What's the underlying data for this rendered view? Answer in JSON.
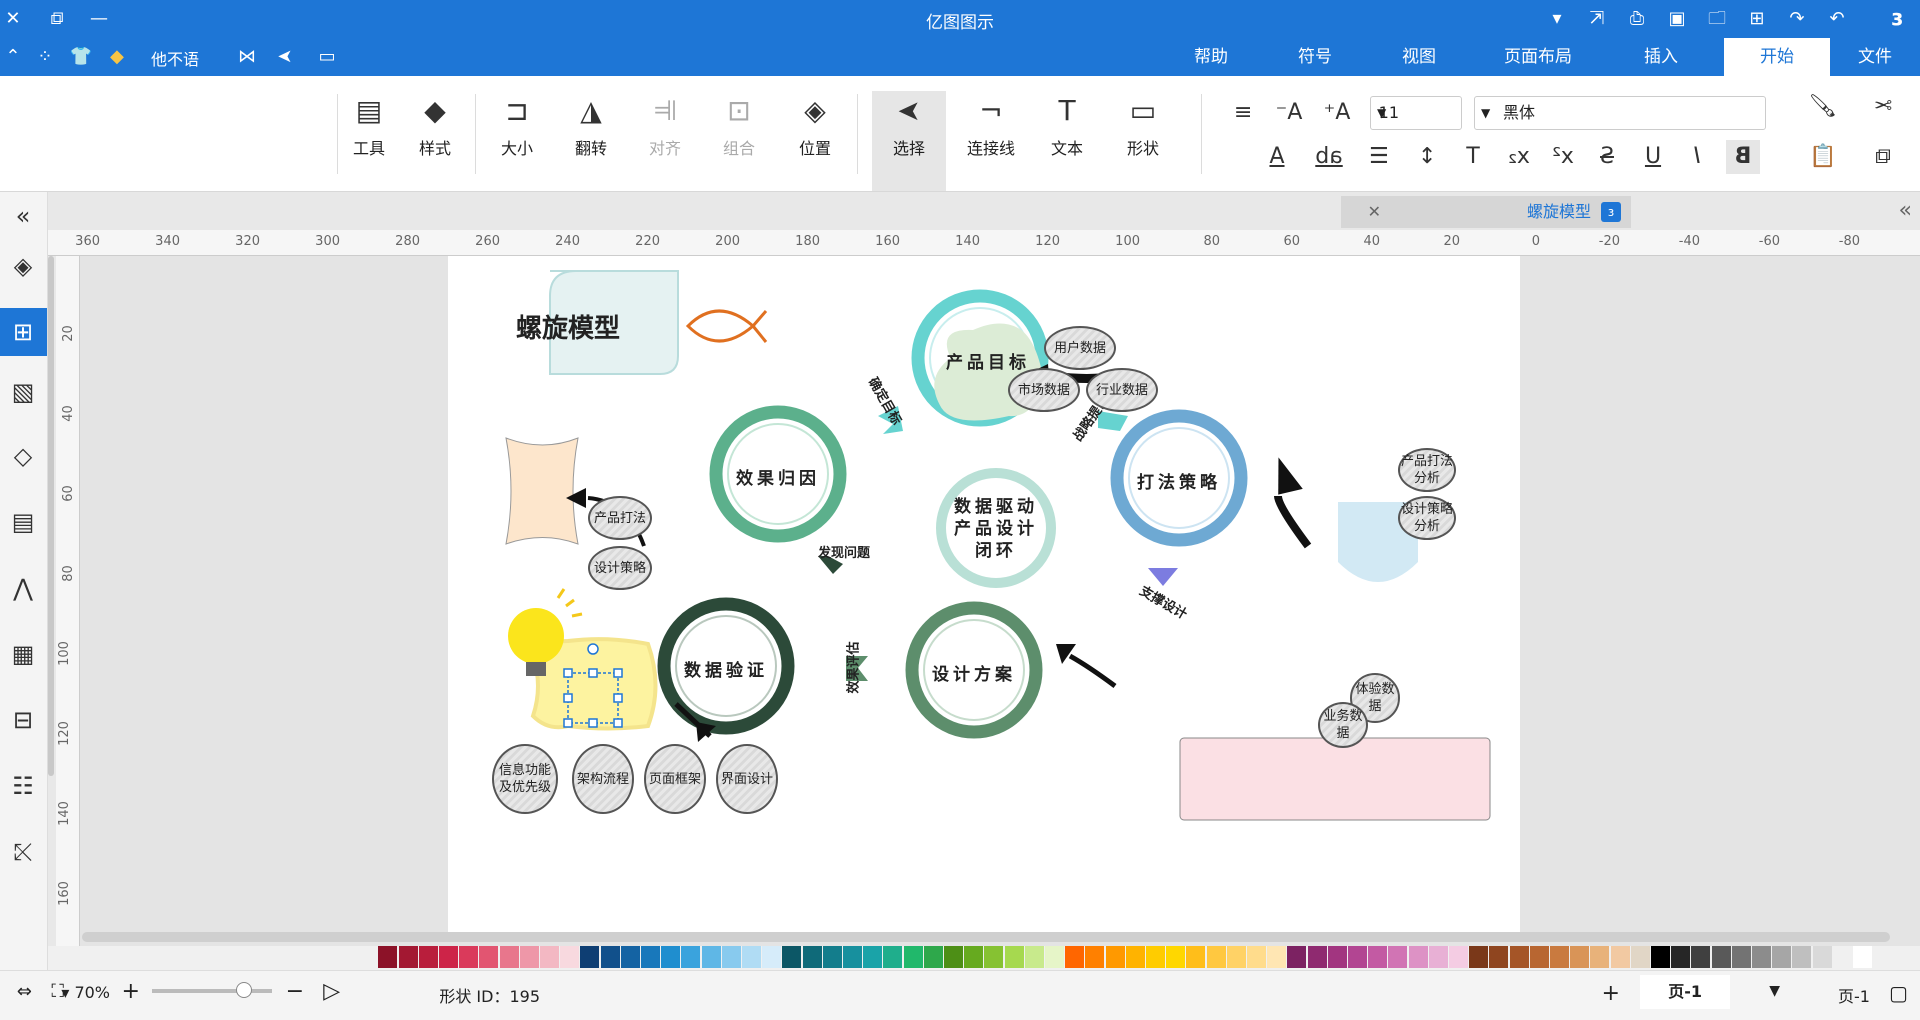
{
  "titlebar": {
    "title": "亿图图示"
  },
  "tabs": [
    "文件",
    "开始",
    "插入",
    "页面布局",
    "视图",
    "符号",
    "帮助"
  ],
  "quick_right": {
    "user": "他不语"
  },
  "ribbon": {
    "clipboard": [
      "剪切",
      "复制",
      "粘贴",
      "格式刷"
    ],
    "font_name": "黑体",
    "font_size": "11",
    "tools": [
      {
        "label": "形状",
        "icon": "rectangle-icon"
      },
      {
        "label": "文本",
        "icon": "text-icon"
      },
      {
        "label": "连接线",
        "icon": "connector-icon"
      },
      {
        "label": "选择",
        "icon": "pointer-icon"
      },
      {
        "label": "位置",
        "icon": "layers-icon"
      },
      {
        "label": "组合",
        "icon": "group-icon"
      },
      {
        "label": "对齐",
        "icon": "align-icon"
      },
      {
        "label": "翻转",
        "icon": "flip-icon"
      },
      {
        "label": "大小",
        "icon": "size-icon"
      },
      {
        "label": "样式",
        "icon": "paint-icon"
      },
      {
        "label": "工具",
        "icon": "tools-icon"
      }
    ]
  },
  "panel": {
    "tab_title": "螺旋模型"
  },
  "ruler": {
    "ticks": [
      "-80",
      "-60",
      "-40",
      "-20",
      "0",
      "20",
      "40",
      "60",
      "80",
      "100",
      "120",
      "140",
      "160",
      "180",
      "200",
      "220",
      "240",
      "260",
      "280",
      "300",
      "320",
      "340",
      "360"
    ]
  },
  "vruler": {
    "ticks": [
      "20",
      "40",
      "60",
      "80",
      "100",
      "120",
      "140",
      "160"
    ]
  },
  "diagram": {
    "title": "螺旋模型",
    "main_nodes": [
      {
        "id": "goal",
        "label": "产品目标"
      },
      {
        "id": "strategy",
        "label": "打法策略"
      },
      {
        "id": "effect",
        "label": "效果归因"
      },
      {
        "id": "center",
        "label": "数据驱动产品设计闭环"
      },
      {
        "id": "design",
        "label": "设计方案"
      },
      {
        "id": "verify",
        "label": "数据验证"
      }
    ],
    "arrow_labels": {
      "confirm_goal": "确定目标",
      "rise": "战略提出",
      "find_problem": "发现问题",
      "support_design": "支撑设计",
      "effect_eval": "效果评估"
    },
    "sub_nodes": {
      "goal": [
        "用户数据",
        "行业数据",
        "市场数据"
      ],
      "strategy": [
        "产品打法",
        "设计策略"
      ],
      "effect": [
        "产品打法分析",
        "设计策略分析"
      ],
      "verify": [
        "体验数据",
        "业务数据"
      ],
      "design": [
        "界面设计",
        "页面框架",
        "架构流程",
        "信息功能及优先级"
      ]
    }
  },
  "statusbar": {
    "page_label": "页-1",
    "page_tab": "页-1",
    "shape_id_label": "形状 ID：",
    "shape_id": "195",
    "zoom": "70%"
  },
  "palette": [
    "#ffffff",
    "#f0f0f0",
    "#d9d9d9",
    "#bfbfbf",
    "#a6a6a6",
    "#8c8c8c",
    "#737373",
    "#595959",
    "#404040",
    "#262626",
    "#000000",
    "#e1d6c6",
    "#f2c9a2",
    "#e8b27a",
    "#d99457",
    "#c97a3f",
    "#b86631",
    "#a55527",
    "#8f451f",
    "#7a3819",
    "#f4cce3",
    "#e8b0d5",
    "#dd92c5",
    "#d174b4",
    "#c35aa3",
    "#b24592",
    "#a23580",
    "#8f2a70",
    "#7c2262",
    "#ffe6b3",
    "#ffdc8c",
    "#ffd266",
    "#ffc840",
    "#ffbe1a",
    "#ffd700",
    "#ffcc00",
    "#ffb300",
    "#ff9900",
    "#ff8000",
    "#ff6600",
    "#e6f5c8",
    "#c8ea8c",
    "#a6d94f",
    "#86c232",
    "#66aa1f",
    "#4d8f16",
    "#2ea84b",
    "#21b86b",
    "#1fae8c",
    "#1aa3a8",
    "#17909e",
    "#137d8c",
    "#0f6a79",
    "#0c5766",
    "#d6ecfa",
    "#b0dcf4",
    "#88caee",
    "#5fb7e6",
    "#3aa3dd",
    "#1f8ecf",
    "#1878bb",
    "#1463a3",
    "#11508b",
    "#0e3e73",
    "#f8d9df",
    "#f3b8c3",
    "#ee97a8",
    "#e8768c",
    "#e25571",
    "#da3a5b",
    "#cd2448",
    "#b91e3c",
    "#a31832",
    "#8c1228"
  ]
}
